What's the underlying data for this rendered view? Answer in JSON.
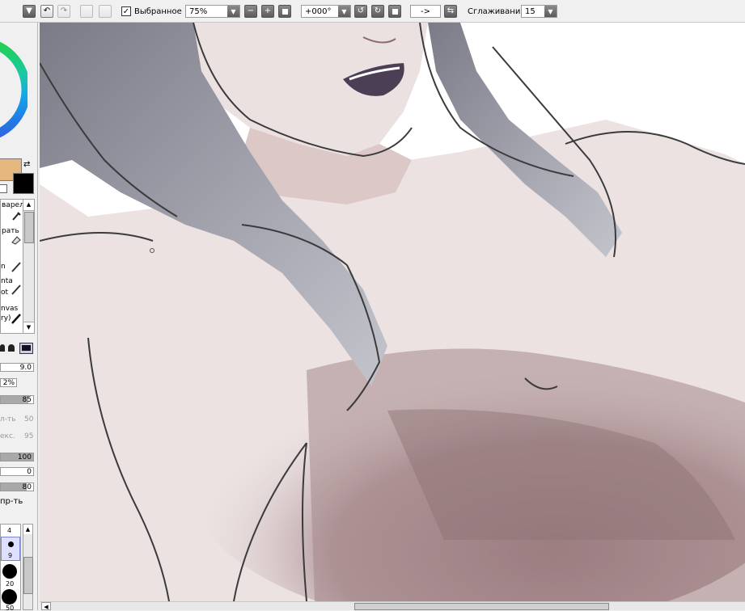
{
  "toolbar": {
    "menu_arrow": "▼",
    "undo_icon": "↶",
    "redo_icon": "↷",
    "selection_checkbox_checked": true,
    "selection_label": "Выбранное",
    "zoom_value": "75%",
    "zoom_out_symbol": "−",
    "zoom_in_symbol": "+",
    "rotation_value": "+000°",
    "flip_label": "->",
    "stabilizer_label": "Сглаживание",
    "stabilizer_value": "15"
  },
  "sidebar": {
    "tools": [
      {
        "label": "варел"
      },
      {
        "label": "рать"
      },
      {
        "label": "n"
      },
      {
        "label": "nta"
      },
      {
        "label": "ot"
      },
      {
        "label": "nvas"
      },
      {
        "label": "ry)"
      }
    ],
    "brush_size_value": "9.0",
    "min_size_value": "2%",
    "density_value": "85",
    "blend_label": "л-ть",
    "blend_value": "50",
    "texture_label": "екс.",
    "texture_value": "95",
    "value_100": "100",
    "value_0": "0",
    "value_80": "80",
    "keep_opacity_label": "пр-ть",
    "brush_sizes": [
      "4",
      "9",
      "20",
      "50"
    ],
    "brush_density": 0.85,
    "slider_100_level": 1.0,
    "slider_80_level": 0.8
  },
  "colors": {
    "primary": "#e3b77e",
    "secondary": "#000000",
    "ui_background": "#f0f0f0"
  },
  "icons": [
    "menu-arrow-icon",
    "undo-icon",
    "redo-icon",
    "select-icon",
    "deselect-icon",
    "zoom-out-icon",
    "zoom-in-icon",
    "zoom-reset-icon",
    "rotate-left-icon",
    "rotate-right-icon",
    "rotate-reset-icon",
    "flip-icon",
    "pen-icon",
    "eyedropper-icon",
    "eraser-icon",
    "scroll-arrow-icon"
  ]
}
